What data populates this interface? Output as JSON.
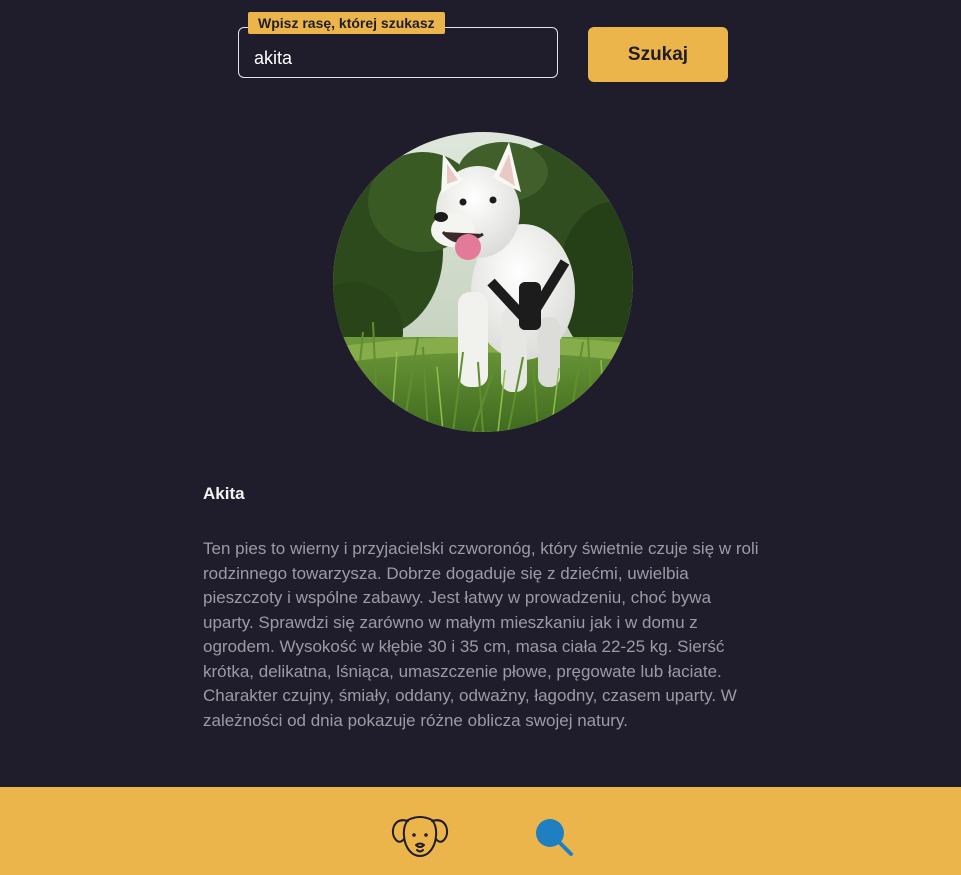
{
  "search": {
    "label": "Wpisz rasę, której szukasz",
    "value": "akita",
    "button_label": "Szukaj"
  },
  "breed": {
    "name": "Akita",
    "description": "Ten pies to wierny i przyjacielski czworonóg, który świetnie czuje się w roli rodzinnego towarzysza. Dobrze dogaduje się z dziećmi, uwielbia pieszczoty i wspólne zabawy. Jest łatwy w prowadzeniu, choć bywa uparty. Sprawdzi się zarówno w małym mieszkaniu jak i w domu z ogrodem. Wysokość w kłębie 30 i 35 cm, masa ciała 22-25 kg. Sierść krótka, delikatna, lśniąca, umaszczenie płowe, pręgowate lub łaciate. Charakter czujny, śmiały, oddany, odważny, łagodny, czasem uparty. W zależności od dnia pokazuje różne oblicza swojej natury."
  },
  "footer": {
    "nav": [
      {
        "icon": "dog-face-icon"
      },
      {
        "icon": "magnifier-icon",
        "active": true
      }
    ]
  },
  "colors": {
    "background": "#1f1d2b",
    "accent": "#ecb54c",
    "active_nav": "#1e7fc1",
    "text_primary": "#f2f2f2",
    "text_secondary": "#9d9aa4"
  }
}
